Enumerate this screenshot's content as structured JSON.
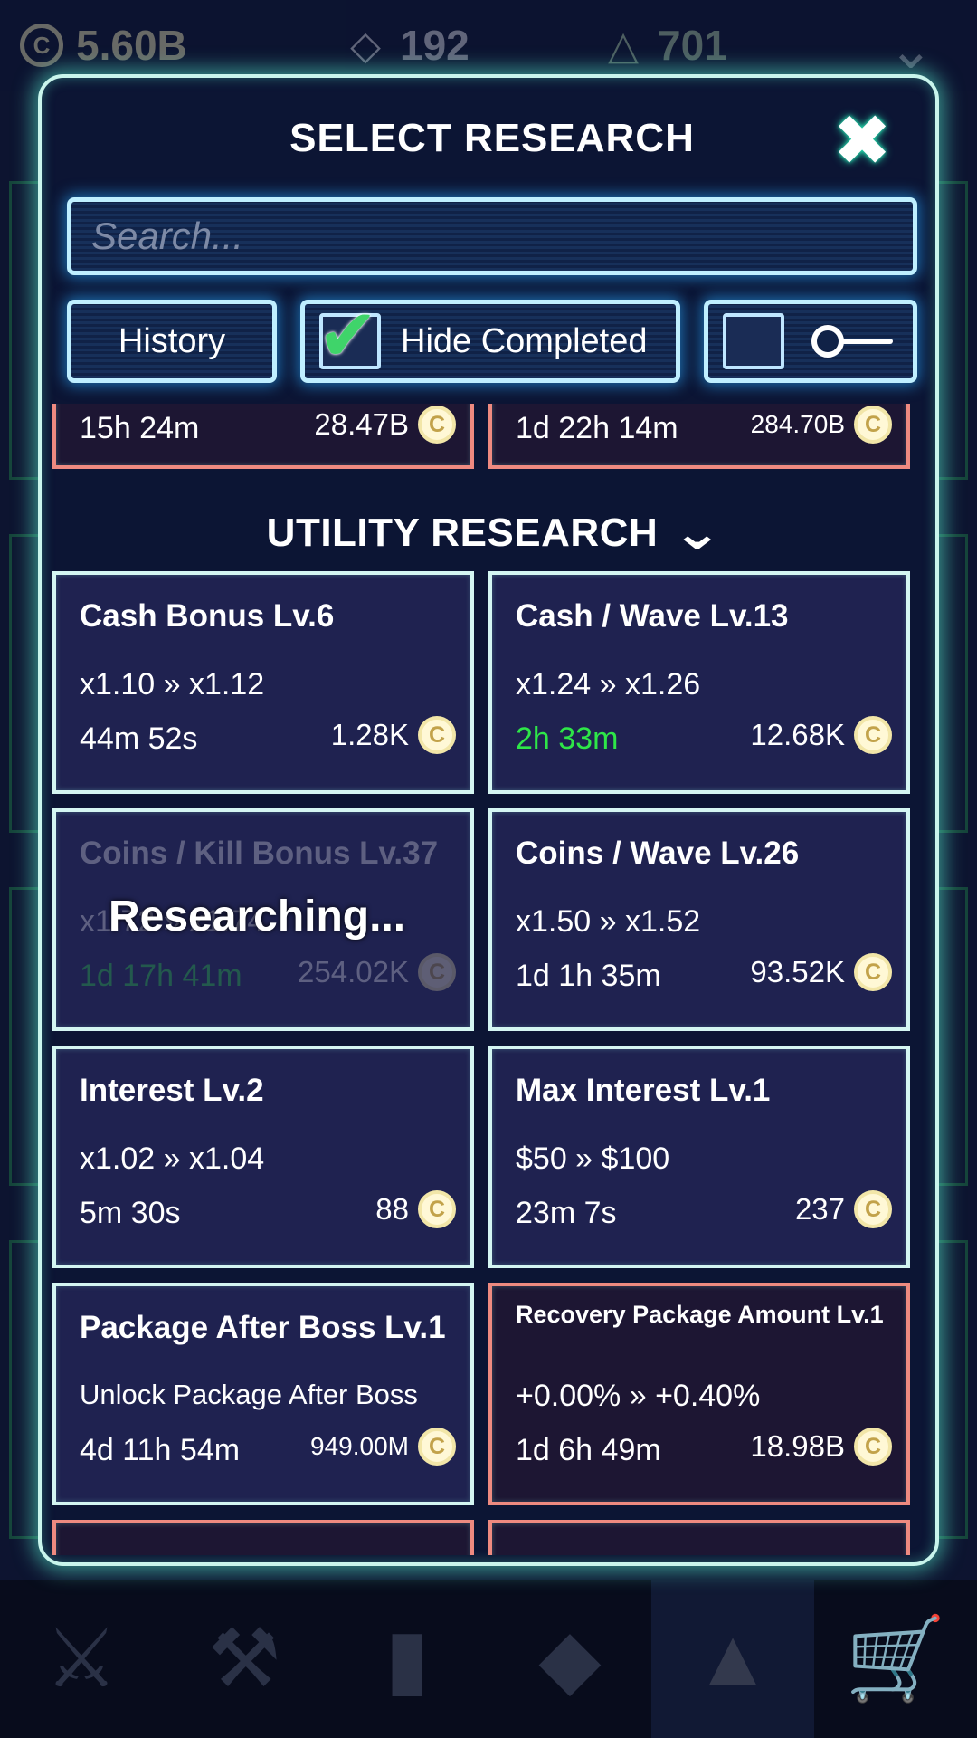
{
  "resources": {
    "coins": "5.60B",
    "gems": "192",
    "medals": "701"
  },
  "modal": {
    "title": "SELECT RESEARCH",
    "search_placeholder": "Search...",
    "history_label": "History",
    "hide_completed_label": "Hide Completed",
    "hide_completed_checked": true
  },
  "top_partial_cards": [
    {
      "time": "15h 24m",
      "cost": "28.47B",
      "maxed": true
    },
    {
      "time": "1d 22h 14m",
      "cost": "284.70B",
      "maxed": true
    }
  ],
  "section": {
    "title": "UTILITY RESEARCH"
  },
  "cards": [
    {
      "name": "Cash Bonus Lv.6",
      "effect": "x1.10 » x1.12",
      "time": "44m 52s",
      "cost": "1.28K"
    },
    {
      "name": "Cash / Wave Lv.13",
      "effect": "x1.24 » x1.26",
      "time": "2h 33m",
      "cost": "12.68K",
      "time_highlight": true
    },
    {
      "name": "Coins / Kill Bonus Lv.37",
      "effect": "x1.72 » x1.74",
      "time": "1d 17h 41m",
      "cost": "254.02K",
      "status": "Researching..."
    },
    {
      "name": "Coins / Wave Lv.26",
      "effect": "x1.50 » x1.52",
      "time": "1d 1h 35m",
      "cost": "93.52K"
    },
    {
      "name": "Interest Lv.2",
      "effect": "x1.02 » x1.04",
      "time": "5m 30s",
      "cost": "88"
    },
    {
      "name": "Max Interest Lv.1",
      "effect": "$50 » $100",
      "time": "23m 7s",
      "cost": "237"
    },
    {
      "name": "Package After Boss Lv.1",
      "effect": "Unlock Package After Boss",
      "time": "4d 11h 54m",
      "cost": "949.00M"
    },
    {
      "name": "Recovery Package Amount Lv.1",
      "effect": "+0.00% » +0.40%",
      "time": "1d 6h 49m",
      "cost": "18.98B",
      "maxed": true
    }
  ],
  "icons": {
    "coin": "coin-icon",
    "close": "close-icon",
    "check": "checkmark-icon",
    "nav": [
      "swords-icon",
      "hammer-icon",
      "card-icon",
      "module-icon",
      "flask-icon",
      "cart-icon"
    ]
  },
  "colors": {
    "accent_cyan": "#c9f5ec",
    "card_bg": "#1f2250",
    "maxed_border": "#ee8a80",
    "time_green": "#2ee648"
  }
}
